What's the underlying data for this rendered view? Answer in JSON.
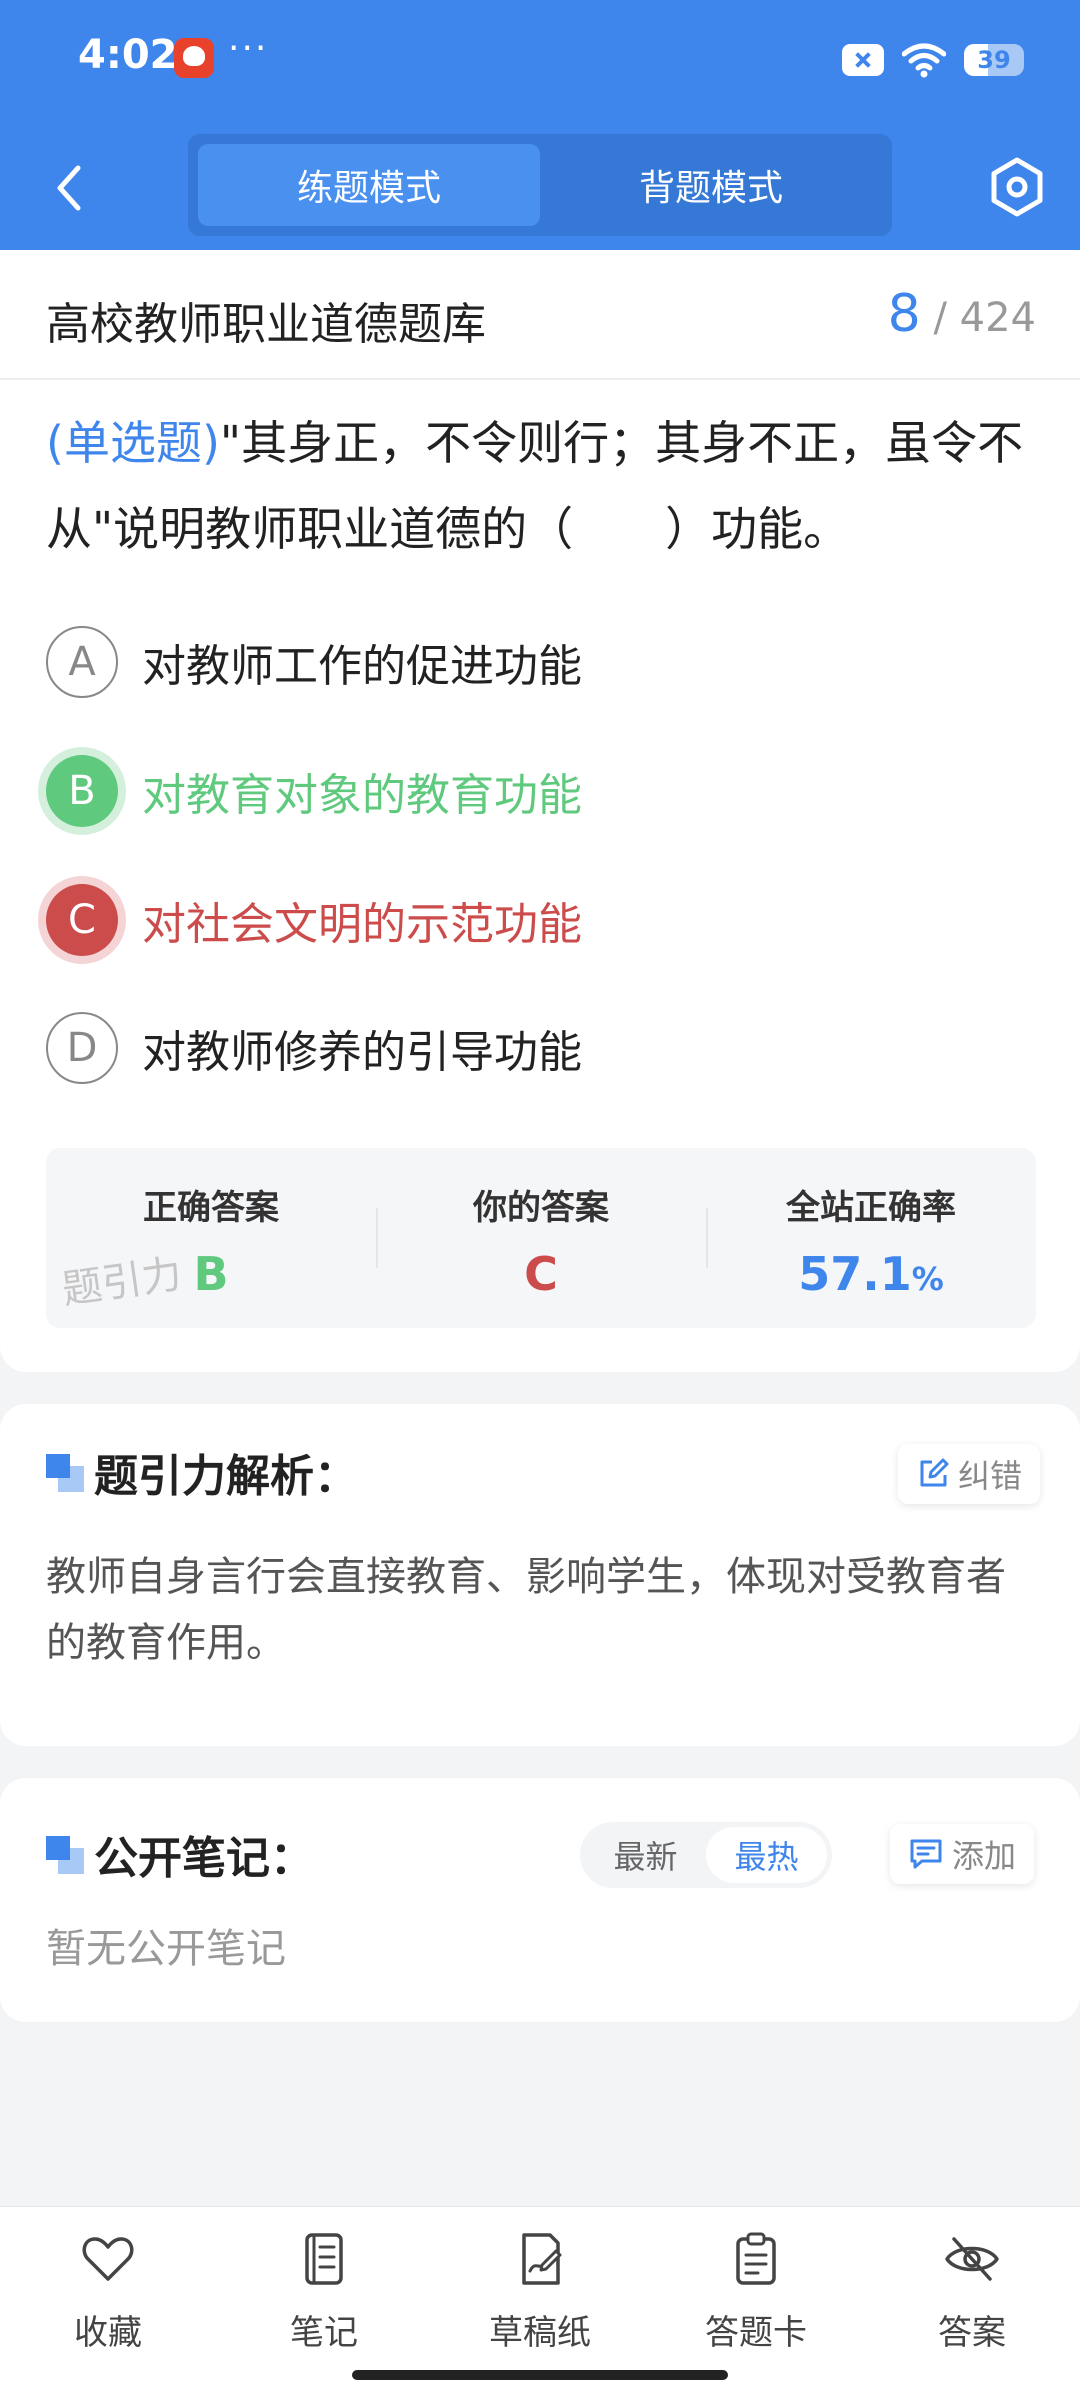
{
  "status_bar": {
    "time": "4:02",
    "dots": "···",
    "battery": "39"
  },
  "header": {
    "tabs": [
      {
        "label": "练题模式",
        "active": true
      },
      {
        "label": "背题模式",
        "active": false
      }
    ],
    "icons": {
      "back": "chevron-left-icon",
      "settings": "hexagon-gear-icon"
    }
  },
  "bank": {
    "title": "高校教师职业道德题库",
    "current": "8",
    "total": "/ 424"
  },
  "question": {
    "type": "(单选题)",
    "text": "\"其身正，不令则行；其身不正，虽令不从\"说明教师职业道德的（　　）功能。"
  },
  "options": [
    {
      "letter": "A",
      "text": "对教师工作的促进功能",
      "state": "normal"
    },
    {
      "letter": "B",
      "text": "对教育对象的教育功能",
      "state": "correct"
    },
    {
      "letter": "C",
      "text": "对社会文明的示范功能",
      "state": "wrong"
    },
    {
      "letter": "D",
      "text": "对教师修养的引导功能",
      "state": "normal"
    }
  ],
  "answers": {
    "correct_label": "正确答案",
    "correct_value": "B",
    "yours_label": "你的答案",
    "yours_value": "C",
    "rate_label": "全站正确率",
    "rate_value": "57.1",
    "rate_unit": "%",
    "watermark": "题引力"
  },
  "analysis": {
    "title": "题引力解析：",
    "report_label": "纠错",
    "text": "教师自身言行会直接教育、影响学生，体现对受教育者的教育作用。"
  },
  "notes": {
    "title": "公开笔记：",
    "sort_options": [
      "最新",
      "最热"
    ],
    "sort_active": "最热",
    "add_label": "添加",
    "empty_text": "暂无公开笔记"
  },
  "toolbar": [
    {
      "label": "收藏",
      "icon": "heart-icon"
    },
    {
      "label": "笔记",
      "icon": "notebook-icon"
    },
    {
      "label": "草稿纸",
      "icon": "scratch-paper-icon"
    },
    {
      "label": "答题卡",
      "icon": "answer-sheet-icon"
    },
    {
      "label": "答案",
      "icon": "eye-off-icon"
    }
  ],
  "colors": {
    "primary": "#3f86ec",
    "correct": "#5fc97e",
    "wrong": "#cc4b4b",
    "background": "#f3f4f6"
  }
}
